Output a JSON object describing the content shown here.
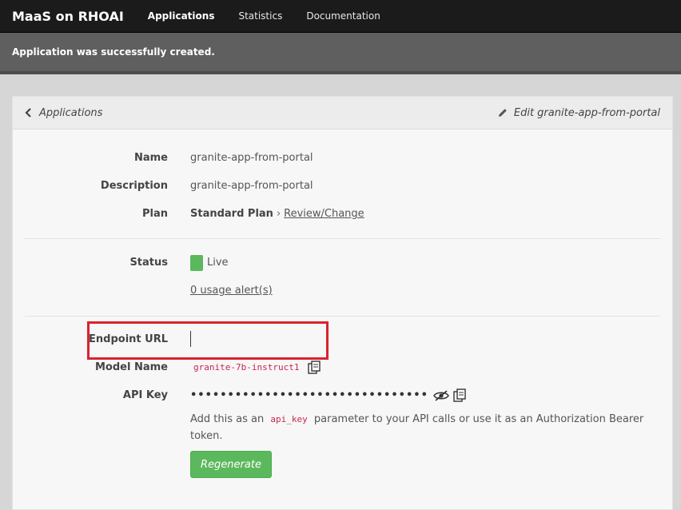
{
  "nav": {
    "brand": "MaaS on RHOAI",
    "links": [
      "Applications",
      "Statistics",
      "Documentation"
    ]
  },
  "flash": {
    "message": "Application was successfully created."
  },
  "header": {
    "back_label": "Applications",
    "edit_label": "Edit granite-app-from-portal"
  },
  "details": {
    "name_label": "Name",
    "name_value": "granite-app-from-portal",
    "description_label": "Description",
    "description_value": "granite-app-from-portal",
    "plan_label": "Plan",
    "plan_value": "Standard Plan",
    "plan_link": "Review/Change",
    "status_label": "Status",
    "status_value": "Live",
    "usage_alerts": "0 usage alert(s)",
    "endpoint_label": "Endpoint URL",
    "endpoint_value": "",
    "model_label": "Model Name",
    "model_value": "granite-7b-instruct1",
    "api_key_label": "API Key",
    "api_key_masked": "••••••••••••••••••••••••••••••••",
    "help_prefix": "Add this as an",
    "help_code": "api_key",
    "help_suffix": "parameter to your API calls or use it as an Authorization Bearer token.",
    "regenerate_label": "Regenerate"
  },
  "colors": {
    "highlight": "#d9232d",
    "status_live": "#5cb85c",
    "button": "#5cb85c"
  }
}
